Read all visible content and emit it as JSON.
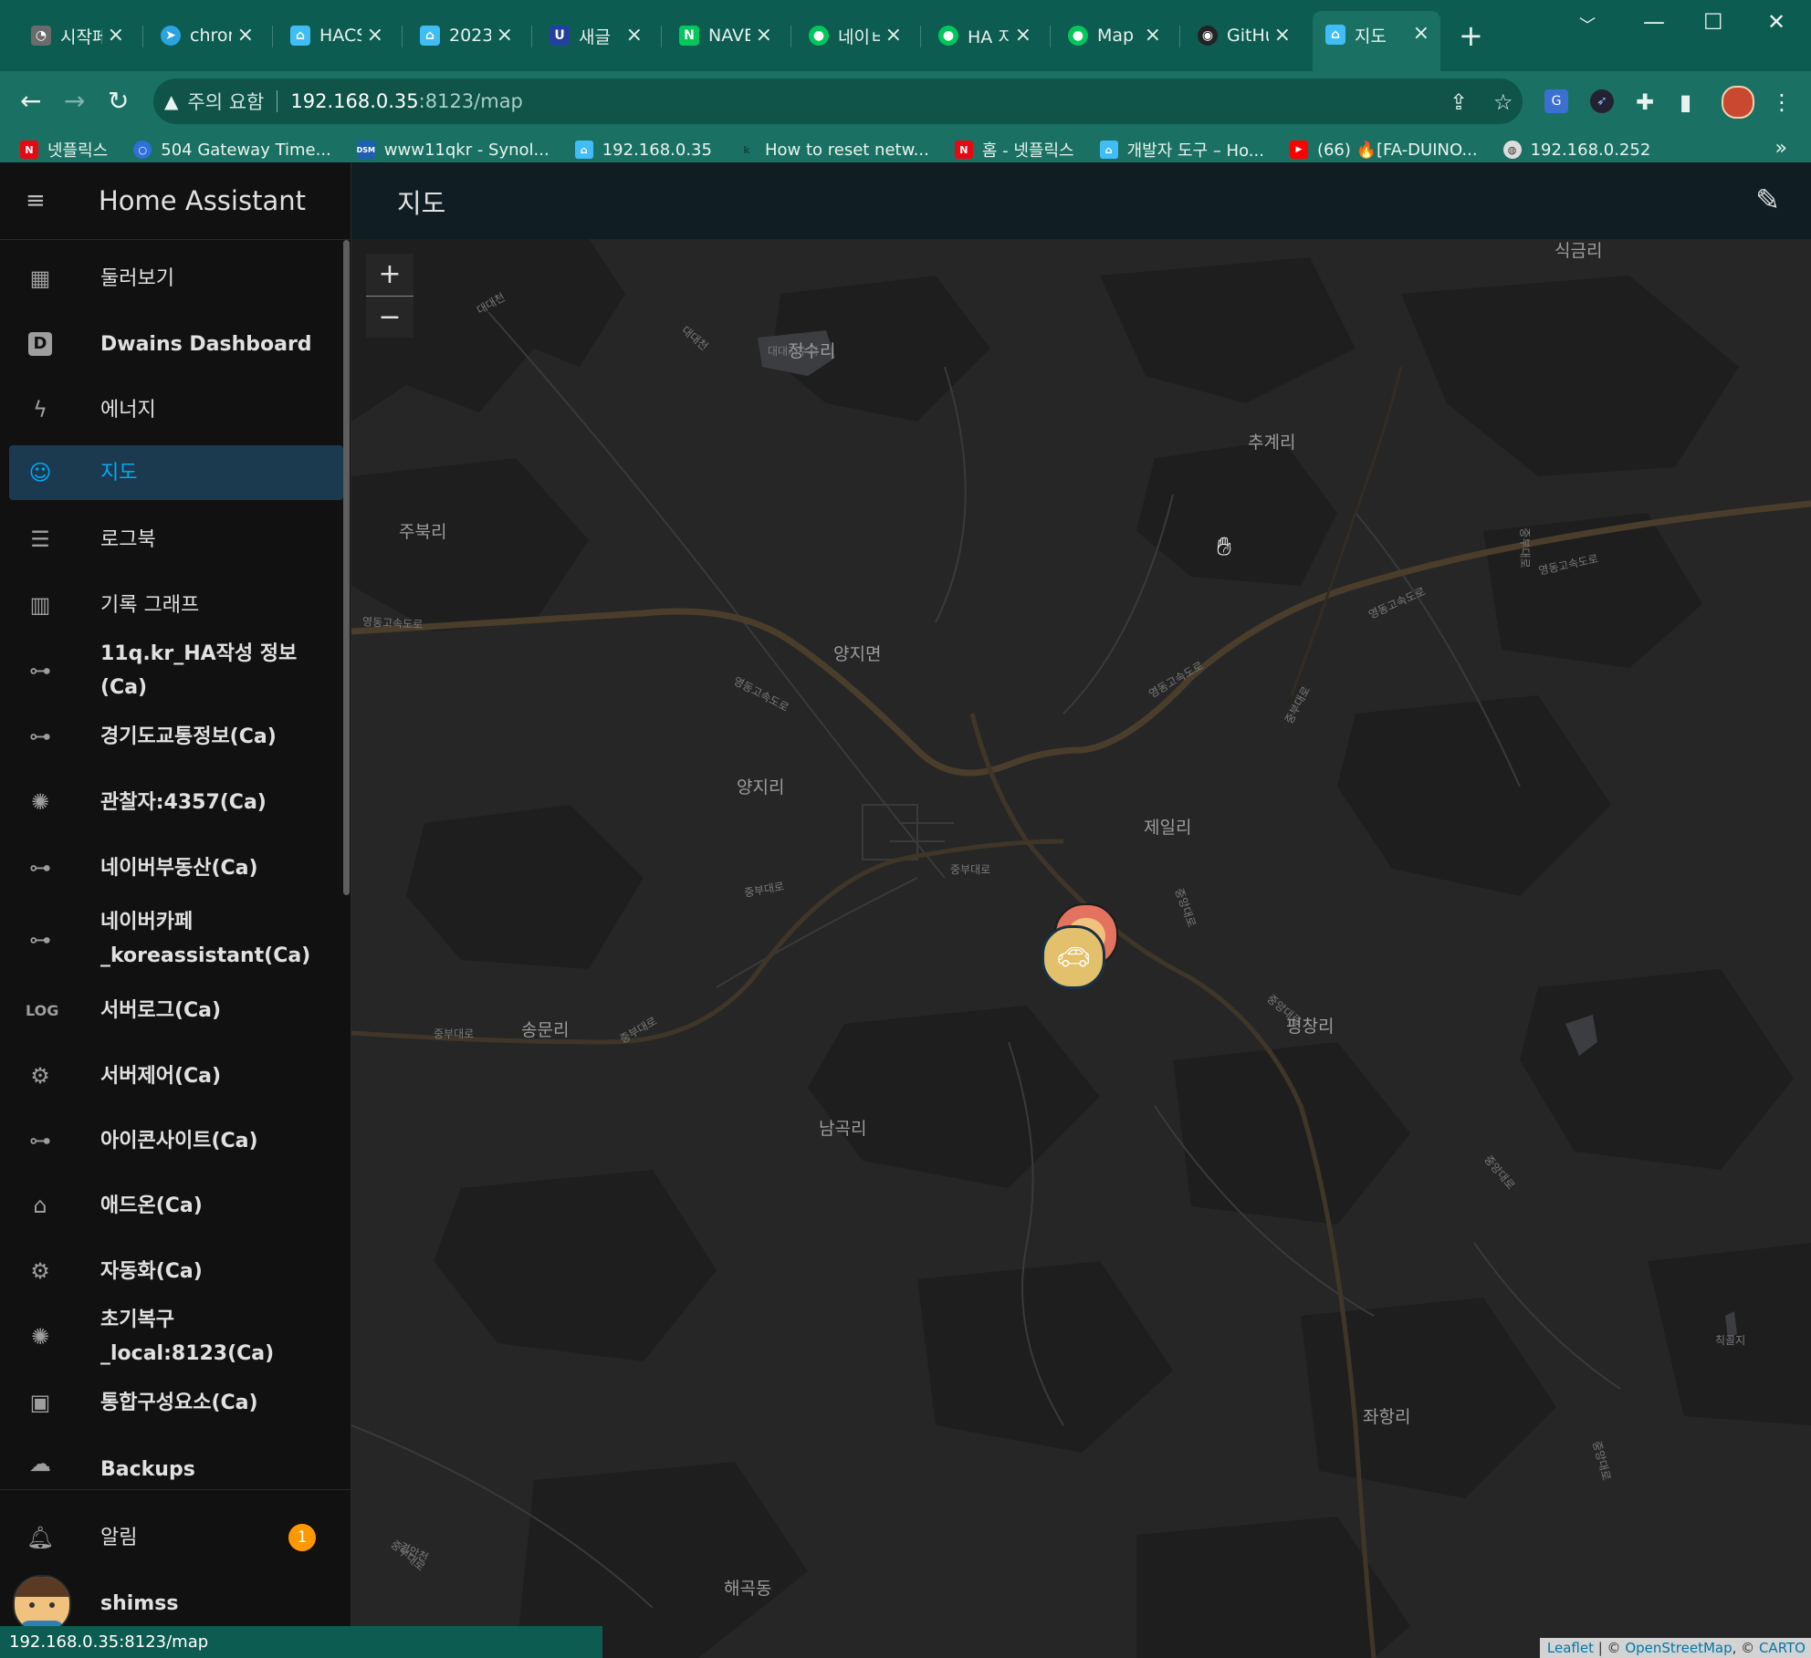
{
  "browser": {
    "tabs": [
      {
        "title": "시작페",
        "fav_color": "#6b6b6b",
        "fav_glyph": "◔"
      },
      {
        "title": "chron",
        "fav_color": "#2aa3e0",
        "fav_glyph": "➤"
      },
      {
        "title": "HACS",
        "fav_color": "#41bdf5",
        "fav_glyph": "⌂"
      },
      {
        "title": "2023.",
        "fav_color": "#41bdf5",
        "fav_glyph": "⌂"
      },
      {
        "title": "새글",
        "fav_color": "#2340a0",
        "fav_glyph": "U"
      },
      {
        "title": "NAVE",
        "fav_color": "#03c75a",
        "fav_glyph": "N"
      },
      {
        "title": "네이ㅂ",
        "fav_color": "#03c75a",
        "fav_glyph": "●"
      },
      {
        "title": "HA 지",
        "fav_color": "#03c75a",
        "fav_glyph": "●"
      },
      {
        "title": "Map",
        "fav_color": "#03c75a",
        "fav_glyph": "●"
      },
      {
        "title": "GitHu",
        "fav_color": "#222222",
        "fav_glyph": "◉"
      },
      {
        "title": "지도",
        "fav_color": "#41bdf5",
        "fav_glyph": "⌂"
      }
    ],
    "active_tab_index": 10,
    "security_warning": "주의 요함",
    "url_host": "192.168.0.35",
    "url_rest": ":8123/map",
    "bookmarks": [
      {
        "label": "넷플릭스",
        "fav_color": "#e50914",
        "fav_glyph": "N"
      },
      {
        "label": "504 Gateway Time...",
        "fav_color": "#2f6fd8",
        "fav_glyph": "○"
      },
      {
        "label": "www11qkr - Synol...",
        "fav_color": "#1d5fb0",
        "fav_glyph": "DSM"
      },
      {
        "label": "192.168.0.35",
        "fav_color": "#41bdf5",
        "fav_glyph": "⌂"
      },
      {
        "label": "How to reset netw...",
        "fav_color": "#1a7163",
        "fav_glyph": "k"
      },
      {
        "label": "홈 - 넷플릭스",
        "fav_color": "#e50914",
        "fav_glyph": "N"
      },
      {
        "label": "개발자 도구 – Ho...",
        "fav_color": "#41bdf5",
        "fav_glyph": "⌂"
      },
      {
        "label": "(66) 🔥[FA-DUINO...",
        "fav_color": "#ff0000",
        "fav_glyph": "▶"
      },
      {
        "label": "192.168.0.252",
        "fav_color": "#dddddd",
        "fav_glyph": "◍"
      }
    ],
    "status_url": "192.168.0.35:8123/map"
  },
  "sidebar": {
    "title": "Home Assistant",
    "items": [
      {
        "label": "둘러보기",
        "icon": "dashboard-icon",
        "glyph": "▦",
        "bold": false
      },
      {
        "label": "Dwains Dashboard",
        "icon": "letter-d-icon",
        "glyph": "D",
        "bold": true
      },
      {
        "label": "에너지",
        "icon": "lightning-icon",
        "glyph": "ϟ",
        "bold": false
      },
      {
        "label": "지도",
        "icon": "map-account-icon",
        "glyph": "☺",
        "bold": false,
        "selected": true
      },
      {
        "label": "로그북",
        "icon": "list-icon",
        "glyph": "☰",
        "bold": false
      },
      {
        "label": "기록 그래프",
        "icon": "chart-bar-icon",
        "glyph": "▥",
        "bold": false
      },
      {
        "label": "11q.kr_HA작성 정보(Ca)",
        "icon": "link-icon",
        "glyph": "⊶",
        "bold": true
      },
      {
        "label": "경기도교통정보(Ca)",
        "icon": "link-icon",
        "glyph": "⊶",
        "bold": true
      },
      {
        "label": "관찰자:4357(Ca)",
        "icon": "lightbulb-icon",
        "glyph": "✺",
        "bold": true
      },
      {
        "label": "네이버부동산(Ca)",
        "icon": "link-icon",
        "glyph": "⊶",
        "bold": true
      },
      {
        "label": "네이버카페_koreassistant(Ca)",
        "line1": "네이버카페",
        "line2": "_koreassistant(Ca)",
        "icon": "link-icon",
        "glyph": "⊶",
        "bold": true
      },
      {
        "label": "서버로그(Ca)",
        "icon": "log-icon",
        "glyph": "LOG",
        "bold": true
      },
      {
        "label": "서버제어(Ca)",
        "icon": "cogs-icon",
        "glyph": "⚙",
        "bold": true
      },
      {
        "label": "아이콘사이트(Ca)",
        "icon": "link-icon",
        "glyph": "⊶",
        "bold": true
      },
      {
        "label": "애드온(Ca)",
        "icon": "home-addon-icon",
        "glyph": "⌂",
        "bold": true
      },
      {
        "label": "자동화(Ca)",
        "icon": "gear-icon",
        "glyph": "⚙",
        "bold": true
      },
      {
        "label": "초기복구_local:8123(Ca)",
        "icon": "lightbulb-icon",
        "glyph": "✺",
        "bold": true
      },
      {
        "label": "통합구성요소(Ca)",
        "icon": "chip-icon",
        "glyph": "▣",
        "bold": true
      },
      {
        "label": "Backups",
        "icon": "cloud-icon",
        "glyph": "☁",
        "bold": true
      }
    ],
    "notifications_label": "알림",
    "notifications_count": "1",
    "user_name": "shimss"
  },
  "main": {
    "page_title": "지도",
    "zoom_in": "+",
    "zoom_out": "−",
    "places": [
      {
        "name": "식금리",
        "id": "place-sikgeumri"
      },
      {
        "name": "정수리",
        "id": "place-jeongsuri"
      },
      {
        "name": "추계리",
        "id": "place-chugyeri"
      },
      {
        "name": "주북리",
        "id": "place-jubukri"
      },
      {
        "name": "양지면",
        "id": "place-yangjimyeon"
      },
      {
        "name": "양지리",
        "id": "place-yangjiri"
      },
      {
        "name": "제일리",
        "id": "place-jeilri"
      },
      {
        "name": "송문리",
        "id": "place-songmunri"
      },
      {
        "name": "평창리",
        "id": "place-pyeongchangri"
      },
      {
        "name": "남곡리",
        "id": "place-namgokri"
      },
      {
        "name": "좌항리",
        "id": "place-jwahangri"
      },
      {
        "name": "해곡동",
        "id": "place-haegokdong"
      }
    ],
    "roads": [
      {
        "name": "영동고속도로"
      },
      {
        "name": "영동고속도로"
      },
      {
        "name": "영동고속도로"
      },
      {
        "name": "영동고속도로"
      },
      {
        "name": "영동고속도로"
      },
      {
        "name": "중부대로"
      },
      {
        "name": "중부대로"
      },
      {
        "name": "중부대로"
      },
      {
        "name": "중부대로"
      },
      {
        "name": "중부대로"
      },
      {
        "name": "중부대로"
      },
      {
        "name": "중부대로"
      },
      {
        "name": "중앙대로"
      },
      {
        "name": "중앙대로"
      },
      {
        "name": "중앙대로"
      },
      {
        "name": "중앙대로"
      },
      {
        "name": "대대천"
      },
      {
        "name": "대대천"
      },
      {
        "name": "대대지수지"
      },
      {
        "name": "칙골지"
      },
      {
        "name": "경안천"
      }
    ],
    "attribution": {
      "leaflet": "Leaflet",
      "sep1": " | © ",
      "osm": "OpenStreetMap",
      "sep2": ", © ",
      "carto": "CARTO"
    }
  },
  "colors": {
    "chrome_tab": "#0d5c52",
    "chrome_toolbar": "#1a7163",
    "sidebar_bg": "#111111",
    "selected_accent": "#03a9f4",
    "header_bg": "#101e24",
    "map_bg": "#262626",
    "badge": "#ff9800"
  }
}
